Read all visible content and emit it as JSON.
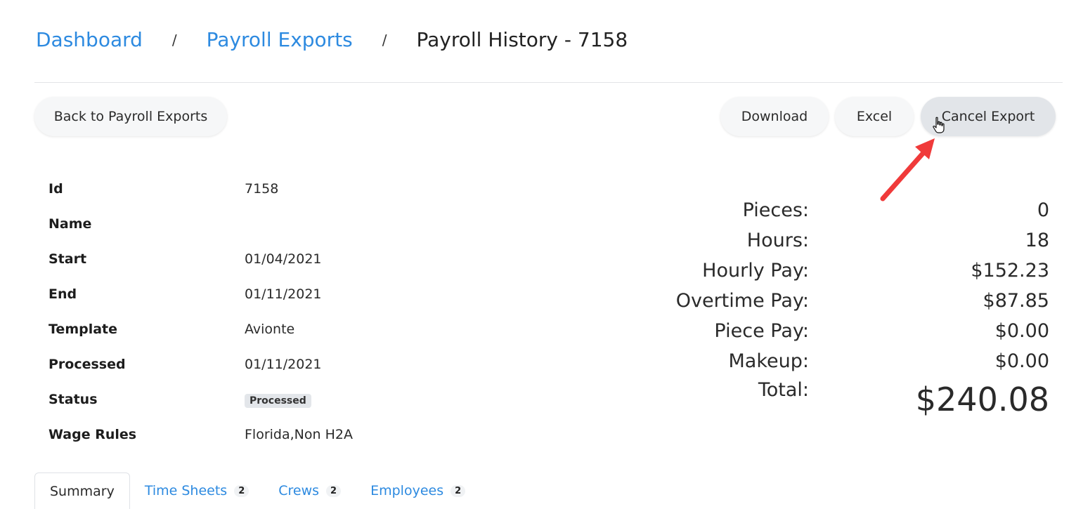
{
  "breadcrumb": {
    "items": [
      "Dashboard",
      "Payroll Exports"
    ],
    "separator": "/",
    "current": "Payroll History - 7158"
  },
  "actions": {
    "back": "Back to Payroll Exports",
    "download": "Download",
    "excel": "Excel",
    "cancel": "Cancel Export"
  },
  "details": [
    {
      "label": "Id",
      "value": "7158"
    },
    {
      "label": "Name",
      "value": ""
    },
    {
      "label": "Start",
      "value": "01/04/2021"
    },
    {
      "label": "End",
      "value": "01/11/2021"
    },
    {
      "label": "Template",
      "value": "Avionte"
    },
    {
      "label": "Processed",
      "value": "01/11/2021"
    },
    {
      "label": "Status",
      "value": "Processed"
    },
    {
      "label": "Wage Rules",
      "value": "Florida,Non H2A"
    }
  ],
  "totals": [
    {
      "label": "Pieces:",
      "value": "0"
    },
    {
      "label": "Hours:",
      "value": "18"
    },
    {
      "label": "Hourly Pay:",
      "value": "$152.23"
    },
    {
      "label": "Overtime Pay:",
      "value": "$87.85"
    },
    {
      "label": "Piece Pay:",
      "value": "$0.00"
    },
    {
      "label": "Makeup:",
      "value": "$0.00"
    },
    {
      "label": "Total:",
      "value": "$240.08"
    }
  ],
  "tabs": [
    {
      "label": "Summary",
      "count": null
    },
    {
      "label": "Time Sheets",
      "count": "2"
    },
    {
      "label": "Crews",
      "count": "2"
    },
    {
      "label": "Employees",
      "count": "2"
    }
  ],
  "colors": {
    "link": "#2d8ae0",
    "annotation_arrow": "#f03a3a"
  },
  "icons": {
    "cursor": "hand-pointer-icon",
    "annotation": "red-arrow-icon"
  }
}
